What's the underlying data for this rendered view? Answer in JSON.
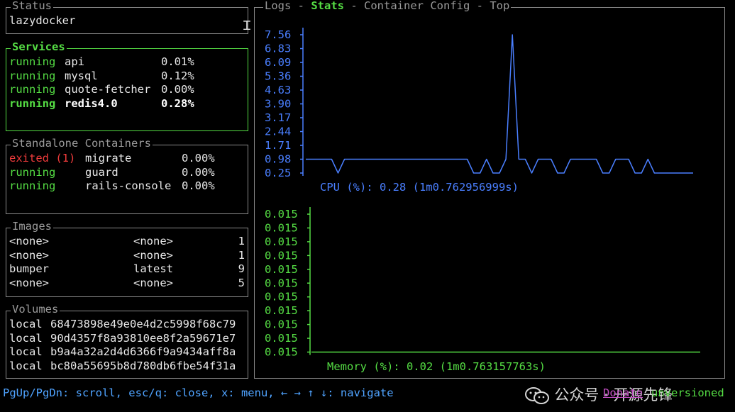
{
  "status": {
    "title": "Status",
    "text": "lazydocker"
  },
  "services": {
    "title": "Services",
    "rows": [
      {
        "state": "running",
        "name": "api",
        "cpu": "0.01%",
        "bold": false
      },
      {
        "state": "running",
        "name": "mysql",
        "cpu": "0.12%",
        "bold": false
      },
      {
        "state": "running",
        "name": "quote-fetcher",
        "cpu": "0.00%",
        "bold": false
      },
      {
        "state": "running",
        "name": "redis4.0",
        "cpu": "0.28%",
        "bold": true
      }
    ]
  },
  "standalone": {
    "title": "Standalone Containers",
    "rows": [
      {
        "state": "exited (1)",
        "name": "migrate",
        "cpu": "0.00%",
        "color": "red"
      },
      {
        "state": "running",
        "name": "guard",
        "cpu": "0.00%",
        "color": "green"
      },
      {
        "state": "running",
        "name": "rails-console",
        "cpu": "0.00%",
        "color": "green"
      }
    ]
  },
  "images": {
    "title": "Images",
    "rows": [
      {
        "name": "<none>",
        "tag": "<none>",
        "size": "1"
      },
      {
        "name": "<none>",
        "tag": "<none>",
        "size": "1"
      },
      {
        "name": "bumper",
        "tag": "latest",
        "size": "9"
      },
      {
        "name": "<none>",
        "tag": "<none>",
        "size": "5"
      }
    ]
  },
  "volumes": {
    "title": "Volumes",
    "rows": [
      {
        "driver": "local",
        "name": "68473898e49e0e4d2c5998f68c79"
      },
      {
        "driver": "local",
        "name": "90d4357f8a93810ee8f2a59671e7"
      },
      {
        "driver": "local",
        "name": "b9a4a32a2d4d6366f9a9434aff8a"
      },
      {
        "driver": "local",
        "name": "bc80a55695b8d780db6fbe54f31a"
      }
    ]
  },
  "main": {
    "tabs": [
      {
        "label": "Logs",
        "active": false
      },
      {
        "label": "Stats",
        "active": true
      },
      {
        "label": "Container Config",
        "active": false
      },
      {
        "label": "Top",
        "active": false
      }
    ],
    "tab_separator": " - "
  },
  "chart_data": [
    {
      "type": "line",
      "title": "CPU (%): 0.28 (1m0.762956999s)",
      "color": "#4a7fff",
      "y_ticks": [
        "7.56",
        "6.83",
        "6.09",
        "5.36",
        "4.63",
        "3.90",
        "3.17",
        "2.44",
        "1.71",
        "0.98",
        "0.25"
      ],
      "ylim": [
        0.25,
        7.56
      ],
      "x": [
        0,
        4,
        5,
        6,
        25,
        26,
        27,
        28,
        29,
        30,
        31,
        32,
        33,
        34,
        35,
        36,
        37,
        38,
        39,
        40,
        41,
        45,
        46,
        47,
        48,
        50,
        51,
        52,
        53,
        54,
        55,
        57,
        58,
        59,
        60
      ],
      "values": [
        0.98,
        0.98,
        0.25,
        0.98,
        0.98,
        0.25,
        0.25,
        0.98,
        0.25,
        0.25,
        0.98,
        7.56,
        0.98,
        0.98,
        0.25,
        0.98,
        0.98,
        0.98,
        0.25,
        0.25,
        0.98,
        0.98,
        0.25,
        0.25,
        0.98,
        0.98,
        0.25,
        0.25,
        0.98,
        0.25,
        0.25,
        0.25,
        0.25,
        0.25,
        0.25
      ]
    },
    {
      "type": "line",
      "title": "Memory (%): 0.02 (1m0.763157763s)",
      "color": "#55dd44",
      "y_ticks": [
        "0.015",
        "0.015",
        "0.015",
        "0.015",
        "0.015",
        "0.015",
        "0.015",
        "0.015",
        "0.015",
        "0.015",
        "0.015"
      ],
      "x": [
        0,
        60
      ],
      "values": [
        0.015,
        0.015
      ]
    }
  ],
  "footer": {
    "help": "PgUp/PgDn: scroll, esc/q: close, x: menu, ← → ↑ ↓: navigate",
    "donate": "Donate",
    "version": "unversioned"
  },
  "watermark": {
    "text": "公众号 · 开源先锋"
  }
}
